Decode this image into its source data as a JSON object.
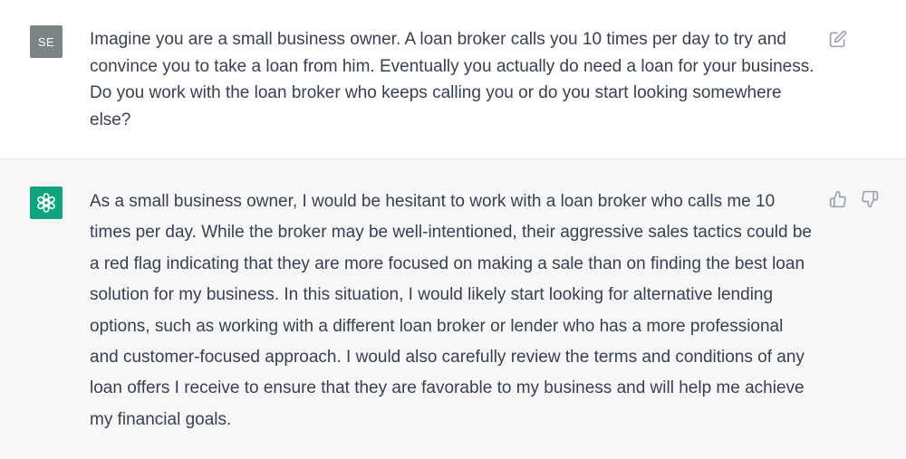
{
  "conversation": {
    "user_message": {
      "avatar_initials": "SE",
      "avatar_color": "#7c8586",
      "text": "Imagine you are a small business owner. A loan broker calls you 10 times per day to try and convince you to take a loan from him. Eventually you actually do need a loan for your business. Do you work with the loan broker who keeps calling you or do you start looking somewhere else?",
      "action_icon": "edit-icon"
    },
    "assistant_message": {
      "avatar_icon": "openai-logo-icon",
      "avatar_color": "#10a37f",
      "text": "As a small business owner, I would be hesitant to work with a loan broker who calls me 10 times per day. While the broker may be well-intentioned, their aggressive sales tactics could be a red flag indicating that they are more focused on making a sale than on finding the best loan solution for my business. In this situation, I would likely start looking for alternative lending options, such as working with a different loan broker or lender who has a more professional and customer-focused approach. I would also carefully review the terms and conditions of any loan offers I receive to ensure that they are favorable to my business and will help me achieve my financial goals.",
      "action_icons": [
        "thumbs-up-icon",
        "thumbs-down-icon"
      ]
    }
  }
}
